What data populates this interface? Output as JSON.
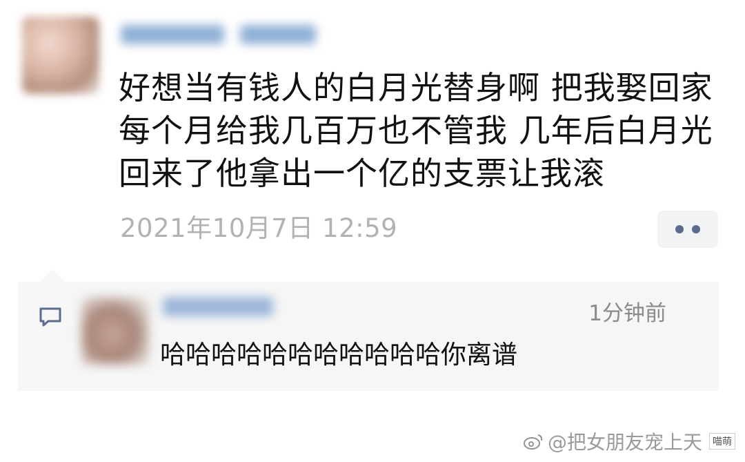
{
  "post": {
    "text_lines": [
      "好想当有钱人的白月光替身啊 把我娶回家",
      "每个月给我几百万也不管我 几年后白月光",
      "回来了他拿出一个亿的支票让我滚"
    ],
    "timestamp": "2021年10月7日 12:59",
    "more_icon": "more-dots-icon"
  },
  "comment": {
    "icon": "comment-icon",
    "time": "1分钟前",
    "text": "哈哈哈哈哈哈哈哈哈哈哈你离谱"
  },
  "watermark": {
    "icon": "weibo-icon",
    "text": "@把女朋友宠上天",
    "site_text": "喵萌"
  },
  "colors": {
    "timestamp": "#b2b2b2",
    "comment_bg": "#f6f6f6",
    "more_dots": "#5a6b8c",
    "body_text": "#111111"
  }
}
